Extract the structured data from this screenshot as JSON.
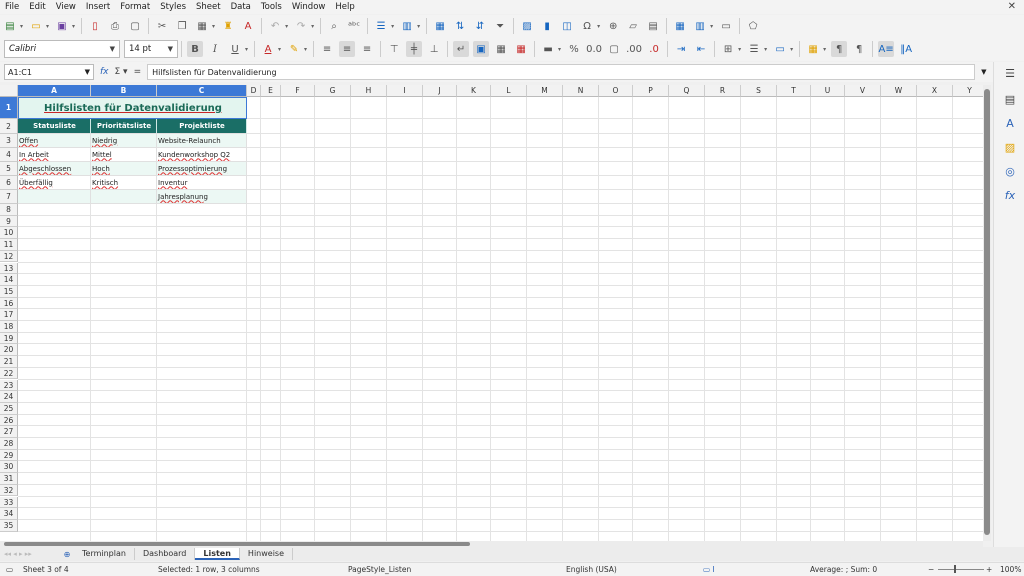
{
  "menu": {
    "items": [
      "File",
      "Edit",
      "View",
      "Insert",
      "Format",
      "Styles",
      "Sheet",
      "Data",
      "Tools",
      "Window",
      "Help"
    ],
    "close": "✕"
  },
  "toolbar2": {
    "font_name": "Calibri",
    "font_size": "14 pt"
  },
  "formula_bar": {
    "name_box": "A1:C1",
    "content": "Hilfslisten für Datenvalidierung"
  },
  "sheet": {
    "columns": [
      "A",
      "B",
      "C",
      "D",
      "E",
      "F",
      "G",
      "H",
      "I",
      "J",
      "K",
      "L",
      "M",
      "N",
      "O",
      "P",
      "Q",
      "R",
      "S",
      "T",
      "U",
      "V",
      "W",
      "X",
      "Y"
    ],
    "row_numbers": [
      "1",
      "2",
      "3",
      "4",
      "5",
      "6",
      "7",
      "8",
      "9",
      "10",
      "11",
      "12",
      "13",
      "14",
      "15",
      "16",
      "17",
      "18",
      "19",
      "20",
      "21",
      "22",
      "23",
      "24",
      "25",
      "26",
      "27",
      "28",
      "29",
      "30",
      "31",
      "32",
      "33",
      "34",
      "35"
    ],
    "title": "Hilfslisten für Datenvalidierung",
    "headers": [
      "Statusliste",
      "Prioritätsliste",
      "Projektliste"
    ],
    "rows": [
      [
        "Offen",
        "Niedrig",
        "Website-Relaunch"
      ],
      [
        "In Arbeit",
        "Mittel",
        "Kundenworkshop Q2"
      ],
      [
        "Abgeschlossen",
        "Hoch",
        "Prozessoptimierung"
      ],
      [
        "Überfällig",
        "Kritisch",
        "Inventur"
      ],
      [
        "",
        "",
        "Jahresplanung"
      ]
    ]
  },
  "tabs": {
    "list": [
      "Terminplan",
      "Dashboard",
      "Listen",
      "Hinweise"
    ],
    "active": "Listen"
  },
  "status": {
    "sheet": "Sheet 3 of 4",
    "selection": "Selected: 1 row, 3 columns",
    "page_style": "PageStyle_Listen",
    "language": "English (USA)",
    "summary": "Average: ; Sum: 0",
    "zoom": "100%"
  },
  "colors": {
    "accent": "#3d79d6",
    "header_fill": "#1a6e66",
    "band_fill": "#ecf8f4",
    "title_fill": "#e3f5ef"
  }
}
